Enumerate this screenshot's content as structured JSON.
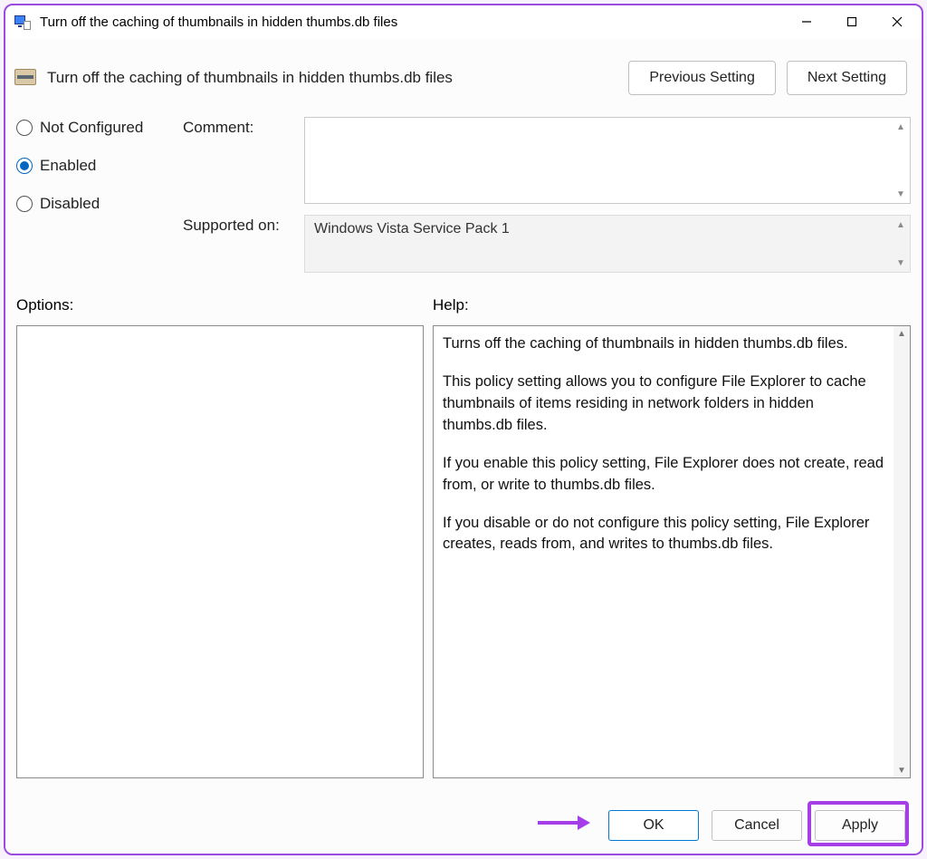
{
  "window": {
    "title": "Turn off the caching of thumbnails in hidden thumbs.db files"
  },
  "header": {
    "policy_title": "Turn off the caching of thumbnails in hidden thumbs.db files",
    "prev_label": "Previous Setting",
    "next_label": "Next Setting"
  },
  "state": {
    "not_configured": "Not Configured",
    "enabled": "Enabled",
    "disabled": "Disabled",
    "selected": "enabled"
  },
  "labels": {
    "comment": "Comment:",
    "supported_on": "Supported on:",
    "options": "Options:",
    "help": "Help:"
  },
  "supported_on_value": "Windows Vista Service Pack 1",
  "help_text": {
    "p1": "Turns off the caching of thumbnails in hidden thumbs.db files.",
    "p2": "This policy setting allows you to configure File Explorer to cache thumbnails of items residing in network folders in hidden thumbs.db files.",
    "p3": "If you enable this policy setting, File Explorer does not create, read from, or write to thumbs.db files.",
    "p4": "If you disable or do not configure this policy setting, File Explorer creates, reads from, and writes to thumbs.db files."
  },
  "buttons": {
    "ok": "OK",
    "cancel": "Cancel",
    "apply": "Apply"
  }
}
